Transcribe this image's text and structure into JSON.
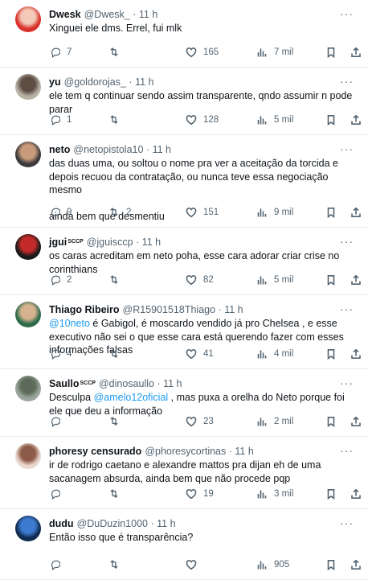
{
  "tweets": [
    {
      "name": "Dwesk",
      "badge": "",
      "handle": "@Dwesk_",
      "time": "11 h",
      "text": "Xinguei ele dms. Errel, fui mlk",
      "replies": "7",
      "retweets": "",
      "likes": "165",
      "views": "7 mil",
      "avatar_colors": [
        "#d8302a",
        "#f3c9b8"
      ]
    },
    {
      "name": "yu",
      "badge": "",
      "handle": "@goldorojas_",
      "time": "11 h",
      "text": "ele tem q continuar sendo assim transparente, qndo assumir n pode parar",
      "replies": "1",
      "retweets": "",
      "likes": "128",
      "views": "5 mil",
      "avatar_colors": [
        "#b9b1a6",
        "#5d4e44"
      ]
    },
    {
      "name": "neto",
      "badge": "",
      "handle": "@netopistola10",
      "time": "11 h",
      "text": "das duas uma, ou soltou o nome pra ver a aceitação da torcida e depois recuou da contratação, ou nunca teve essa negociação mesmo\n\nainda bem que desmentiu",
      "replies": "9",
      "retweets": "2",
      "likes": "151",
      "views": "9 mil",
      "avatar_colors": [
        "#3a3a3a",
        "#c99b7c"
      ]
    },
    {
      "name": "jgui",
      "badge": "SCCP",
      "handle": "@jguisccp",
      "time": "11 h",
      "text": "os caras acreditam em neto poha, esse cara adorar criar crise no corinthians",
      "replies": "2",
      "retweets": "",
      "likes": "82",
      "views": "5 mil",
      "avatar_colors": [
        "#1b1b1b",
        "#c52a2a"
      ]
    },
    {
      "name": "Thiago Ribeiro",
      "badge": "",
      "handle": "@R15901518Thiago",
      "time": "11 h",
      "mention": "@10neto",
      "text": " é Gabigol, é moscardo vendido já pro Chelsea , e esse executivo não sei o que esse cara está querendo fazer com esses informações falsas",
      "replies": "4",
      "retweets": "",
      "likes": "41",
      "views": "4 mil",
      "avatar_colors": [
        "#2e6b4a",
        "#d6b28f"
      ]
    },
    {
      "name": "Saullo",
      "badge": "SCCP",
      "handle": "@dinosaullo",
      "time": "11 h",
      "pre": "Desculpa ",
      "mention": "@amelo12oficial",
      "text": " , mas puxa a orelha do Neto porque foi ele que deu a informação",
      "replies": "",
      "retweets": "",
      "likes": "23",
      "views": "2 mil",
      "avatar_colors": [
        "#9aa59b",
        "#5c6b5a"
      ]
    },
    {
      "name": "phoresy censurado",
      "badge": "",
      "handle": "@phoresycortinas",
      "time": "11 h",
      "text": "ir de rodrigo caetano e alexandre mattos pra dijan eh de uma sacanagem absurda, ainda bem que não procede pqp",
      "replies": "",
      "retweets": "",
      "likes": "19",
      "views": "3 mil",
      "avatar_colors": [
        "#e9d7cf",
        "#8c5a46"
      ]
    },
    {
      "name": "dudu",
      "badge": "",
      "handle": "@DuDuzin1000",
      "time": "11 h",
      "text": "Então isso que é transparência?",
      "replies": "",
      "retweets": "",
      "likes": "",
      "views": "905",
      "avatar_colors": [
        "#0f2b4f",
        "#3d7bd1"
      ]
    }
  ],
  "separator": "·"
}
